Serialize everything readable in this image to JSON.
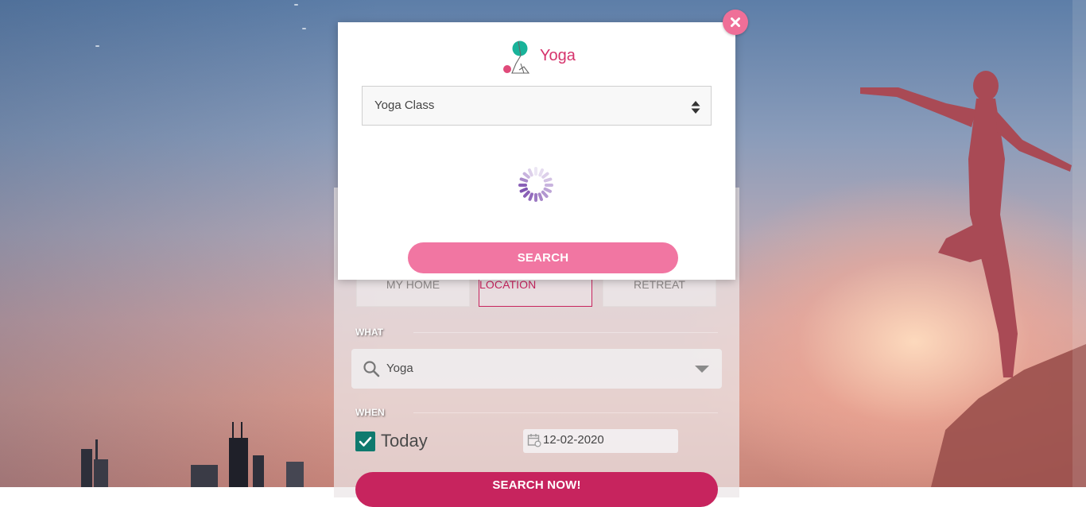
{
  "modal": {
    "title": "Yoga",
    "class_select": {
      "selected": "Yoga Class"
    },
    "search_label": "SEARCH",
    "loading": true
  },
  "location_options": [
    {
      "label": "MY HOME",
      "active": false
    },
    {
      "label": "HEALER'S LOCATION",
      "active": true
    },
    {
      "label": "RETREAT",
      "active": false
    }
  ],
  "what": {
    "label": "WHAT",
    "value": "Yoga"
  },
  "when": {
    "label": "WHEN",
    "today_label": "Today",
    "today_checked": true,
    "date": "12-02-2020"
  },
  "search_now_label": "SEARCH NOW!",
  "colors": {
    "accent": "#c7245e",
    "modal_button": "#f176a2",
    "close_button": "#ef6f98",
    "checkbox": "#0f7a6e"
  },
  "icons": {
    "close": "close-icon",
    "logo": "yoga-logo-icon",
    "spinner": "loading-spinner-icon",
    "search": "search-icon",
    "calendar": "calendar-icon",
    "dropdown": "chevron-down-icon",
    "check": "check-icon"
  }
}
